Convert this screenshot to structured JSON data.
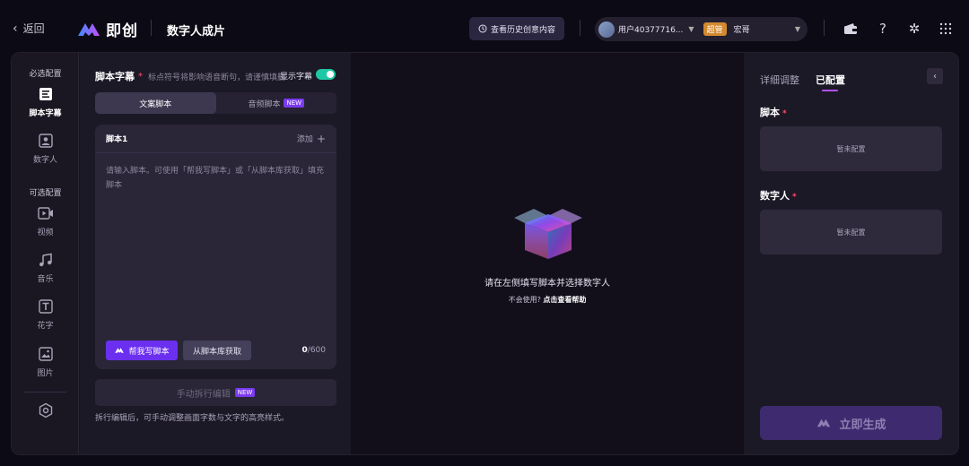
{
  "topbar": {
    "back_label": "返回",
    "brand": "即创",
    "page_title": "数字人成片",
    "history_button": "查看历史创意内容",
    "account": {
      "user": "用户40377716...",
      "role_badge": "超管",
      "team": "宏哥"
    },
    "icons": [
      "wallet-icon",
      "help-icon",
      "settings-icon",
      "apps-grid-icon"
    ]
  },
  "rail": {
    "required_section": "必选配置",
    "optional_section": "可选配置",
    "items": [
      {
        "label": "脚本字幕",
        "icon": "script-subtitle-icon",
        "active": true
      },
      {
        "label": "数字人",
        "icon": "digital-human-icon",
        "active": false
      },
      {
        "label": "视频",
        "icon": "video-icon",
        "active": false
      },
      {
        "label": "音乐",
        "icon": "music-icon",
        "active": false
      },
      {
        "label": "花字",
        "icon": "text-effect-icon",
        "active": false
      },
      {
        "label": "图片",
        "icon": "image-icon",
        "active": false
      }
    ],
    "bottom_icon": "hexagon-settings-icon"
  },
  "script_panel": {
    "title": "脚本字幕",
    "required_mark": "*",
    "hint": "标点符号将影响语音断句，请谨慎填删",
    "show_subtitle_label": "显示字幕",
    "show_subtitle_on": true,
    "tabs": [
      {
        "label": "文案脚本",
        "active": true
      },
      {
        "label": "音频脚本",
        "badge": "NEW",
        "active": false
      }
    ],
    "editor": {
      "name": "脚本1",
      "add_label": "添加",
      "placeholder": "请输入脚本。可使用「帮我写脚本」或「从脚本库获取」填充脚本",
      "value": "",
      "help_write_button": "帮我写脚本",
      "library_button": "从脚本库获取",
      "count": "0",
      "max": "/600"
    },
    "manual_edit_button": "手动拆行编辑",
    "manual_edit_badge": "NEW",
    "manual_edit_hint": "拆行编辑后，可手动调整画面字数与文字的高亮样式。"
  },
  "preview": {
    "message": "请在左侧填写脚本并选择数字人",
    "sub_prefix": "不会使用?",
    "sub_link": "点击查看帮助"
  },
  "right_panel": {
    "tabs": [
      {
        "label": "详细调整",
        "active": false
      },
      {
        "label": "已配置",
        "active": true
      }
    ],
    "script_label": "脚本",
    "script_slot": "暂未配置",
    "human_label": "数字人",
    "human_slot": "暂未配置",
    "required_mark": "*",
    "generate_button": "立即生成"
  },
  "colors": {
    "accent_purple": "#6b2ff0",
    "toggle_on": "#1fc8a4",
    "required_red": "#ff4d6d",
    "badge_orange": "#d38a2f"
  }
}
